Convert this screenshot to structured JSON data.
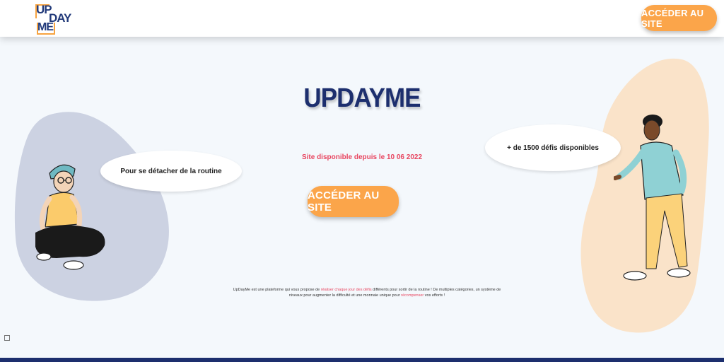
{
  "header": {
    "logo": {
      "part1": "UP",
      "part2": "DAY",
      "part3": "ME"
    },
    "cta_label": "ACCÉDER AU SITE"
  },
  "main": {
    "title": "UPDAYME",
    "since_text": "Site disponible depuis le 10 06 2022",
    "cta_label": "ACCÉDER AU SITE",
    "description": {
      "p1": "UpDayMe est une plateforme qui vous propose de ",
      "hl1": "réaliser chaque jour des défis",
      "p2": " différents pour sortir de la routine ! De multiples catégories, un système de niveaux pour augmenter la difficulté et une monnaie unique pour ",
      "hl2": "récompenser",
      "p3": " vos efforts !"
    }
  },
  "bubbles": {
    "left": "Pour se détacher de la routine",
    "right": "+ de 1500 défis disponibles"
  },
  "colors": {
    "accent": "#fba54a",
    "brand": "#1d2f6e",
    "highlight": "#e84660",
    "blob_left": "#ccd2e2",
    "blob_right": "#fae3c9"
  },
  "icons": {
    "corner": "small-square-icon"
  }
}
